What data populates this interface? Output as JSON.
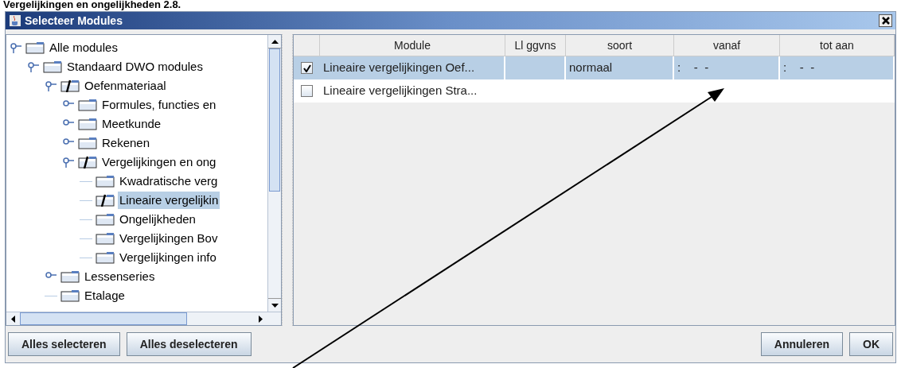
{
  "heading": "Vergelijkingen en ongelijkheden 2.8.",
  "window": {
    "title": "Selecteer Modules"
  },
  "tree": [
    {
      "label": "Alle modules",
      "kind": "branch",
      "expanded": true,
      "marked": false,
      "selected": false,
      "children": [
        {
          "label": "Standaard DWO modules",
          "kind": "branch",
          "expanded": true,
          "marked": false,
          "selected": false,
          "children": [
            {
              "label": "Oefenmateriaal",
              "kind": "branch",
              "expanded": true,
              "marked": true,
              "selected": false,
              "children": [
                {
                  "label": "Formules, functies en",
                  "kind": "branch",
                  "expanded": false,
                  "marked": false,
                  "selected": false
                },
                {
                  "label": "Meetkunde",
                  "kind": "branch",
                  "expanded": false,
                  "marked": false,
                  "selected": false
                },
                {
                  "label": "Rekenen",
                  "kind": "branch",
                  "expanded": false,
                  "marked": false,
                  "selected": false
                },
                {
                  "label": "Vergelijkingen en ong",
                  "kind": "branch",
                  "expanded": true,
                  "marked": true,
                  "selected": false,
                  "children": [
                    {
                      "label": "Kwadratische verg",
                      "kind": "leaf",
                      "marked": false,
                      "selected": false
                    },
                    {
                      "label": "Lineaire vergelijkin",
                      "kind": "leaf",
                      "marked": true,
                      "selected": true
                    },
                    {
                      "label": "Ongelijkheden",
                      "kind": "leaf",
                      "marked": false,
                      "selected": false
                    },
                    {
                      "label": "Vergelijkingen Bov",
                      "kind": "leaf",
                      "marked": false,
                      "selected": false
                    },
                    {
                      "label": "Vergelijkingen info",
                      "kind": "leaf",
                      "marked": false,
                      "selected": false
                    }
                  ]
                }
              ]
            },
            {
              "label": "Lessenseries",
              "kind": "branch",
              "expanded": false,
              "marked": false,
              "selected": false
            },
            {
              "label": "Etalage",
              "kind": "leaf",
              "marked": false,
              "selected": false
            }
          ]
        }
      ]
    }
  ],
  "table": {
    "columns": [
      "Module",
      "Ll ggvns",
      "soort",
      "vanaf",
      "tot aan"
    ],
    "rows": [
      {
        "checked": true,
        "selected": true,
        "cells": [
          "Lineaire vergelijkingen Oef...",
          "",
          "normaal",
          ":    -  -",
          ":    -  -"
        ]
      },
      {
        "checked": false,
        "selected": false,
        "cells": [
          "Lineaire vergelijkingen Stra...",
          "",
          "",
          "",
          ""
        ]
      }
    ]
  },
  "buttons_left": [
    "Alles selecteren",
    "Alles deselecteren"
  ],
  "buttons_right": [
    "Annuleren",
    "OK"
  ]
}
